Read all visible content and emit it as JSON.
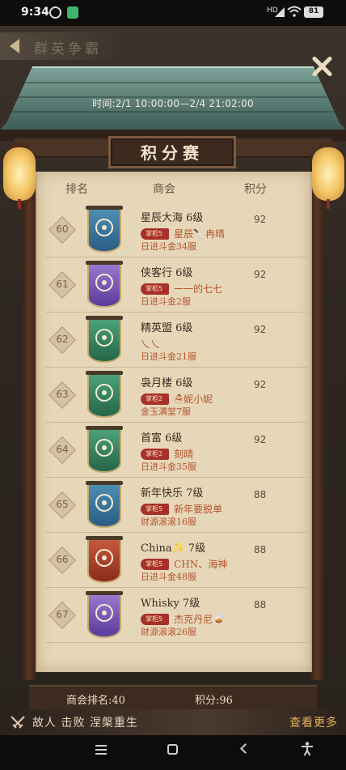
{
  "status": {
    "time": "9:34",
    "battery": "81",
    "net": "HD"
  },
  "game": {
    "title": "群英争霸",
    "time_range": "时间:2/1 10:00:00—2/4 21:02:00",
    "plaque": "积分赛",
    "headers": {
      "rank": "排名",
      "guild": "商会",
      "score": "积分"
    },
    "rows": [
      {
        "rank": "60",
        "name": "星辰大海 6级",
        "badge": "掌柜5",
        "leader": "星辰🔪冉晴",
        "server": "日进斗金34服",
        "score": "92",
        "color": "blue"
      },
      {
        "rank": "61",
        "name": "侠客行 6级",
        "badge": "掌柜5",
        "leader": "一一的七七",
        "server": "日进斗金2服",
        "score": "92",
        "color": "purple"
      },
      {
        "rank": "62",
        "name": "精英盟 6级",
        "badge": "",
        "leader": "乀乀",
        "server": "日进斗金21服",
        "score": "92",
        "color": "green"
      },
      {
        "rank": "63",
        "name": "袅月楼 6级",
        "badge": "掌柜2",
        "leader": "☃妮小妮",
        "server": "金玉满堂7服",
        "score": "92",
        "color": "green"
      },
      {
        "rank": "64",
        "name": "首富 6级",
        "badge": "掌柜2",
        "leader": "刻晴",
        "server": "日进斗金35服",
        "score": "92",
        "color": "green"
      },
      {
        "rank": "65",
        "name": "新年快乐 7级",
        "badge": "掌柜5",
        "leader": "新年要脱单",
        "server": "财源滚滚16服",
        "score": "88",
        "color": "blue"
      },
      {
        "rank": "66",
        "name": "China✨ 7级",
        "badge": "掌柜5",
        "leader": "CHN、海神",
        "server": "日进斗金48服",
        "score": "88",
        "color": "red"
      },
      {
        "rank": "67",
        "name": "Whisky 7级",
        "badge": "掌柜5",
        "leader": "杰克丹尼🥃",
        "server": "财源滚滚26服",
        "score": "88",
        "color": "purple"
      }
    ],
    "my_rank": "商会排名:40",
    "my_score": "积分:96",
    "ticker": "故人 击败 涅槃重生",
    "more": "查看更多"
  }
}
